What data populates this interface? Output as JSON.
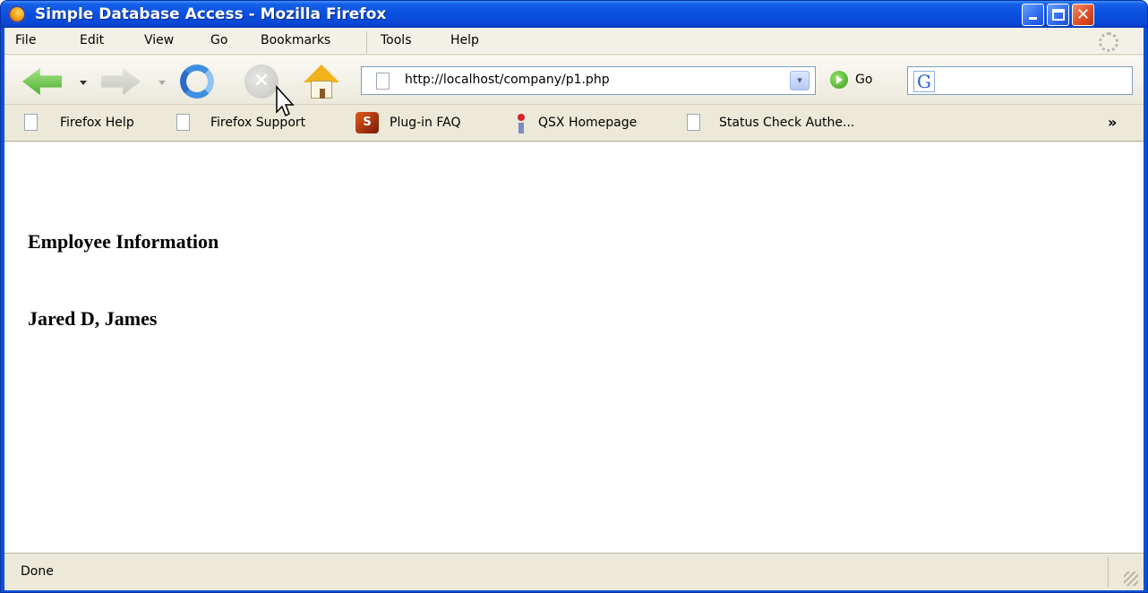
{
  "window": {
    "title": "Simple Database Access - Mozilla Firefox",
    "buttons": {
      "minimize": "",
      "maximize": "",
      "close": "✕"
    }
  },
  "menubar": {
    "items": [
      {
        "label": "File"
      },
      {
        "label": "Edit"
      },
      {
        "label": "View"
      },
      {
        "label": "Go"
      },
      {
        "label": "Bookmarks"
      },
      {
        "label": "Tools"
      },
      {
        "label": "Help"
      }
    ]
  },
  "navbar": {
    "url": "http://localhost/company/p1.php",
    "go_label": "Go",
    "stop_glyph": "✕",
    "search_engine_glyph": "G"
  },
  "bookmarks": {
    "items": [
      {
        "label": "Firefox Help",
        "icon": "page-icon"
      },
      {
        "label": "Firefox Support",
        "icon": "page-icon"
      },
      {
        "label": "Plug-in FAQ",
        "icon": "plugin-icon"
      },
      {
        "label": "QSX Homepage",
        "icon": "info-icon"
      },
      {
        "label": "Status Check Authe...",
        "icon": "page-icon"
      }
    ],
    "overflow": "»"
  },
  "content": {
    "heading": "Employee Information",
    "employee_name": "Jared D, James"
  },
  "statusbar": {
    "text": "Done"
  },
  "colors": {
    "titlebar": "#0a4fe0",
    "chrome": "#ece9d8",
    "close_button": "#dc4b23"
  }
}
